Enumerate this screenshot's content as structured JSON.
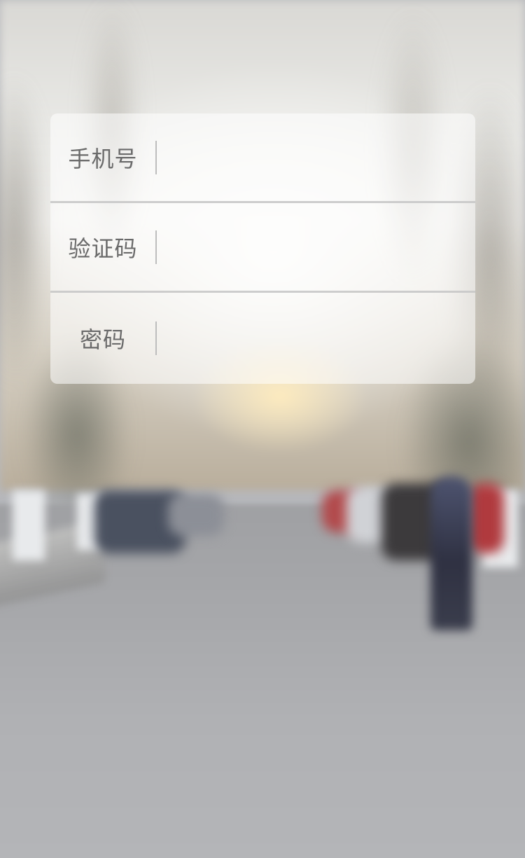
{
  "login_form": {
    "fields": [
      {
        "label": "手机号",
        "value": "",
        "placeholder": ""
      },
      {
        "label": "验证码",
        "value": "",
        "placeholder": ""
      },
      {
        "label": "密码",
        "value": "",
        "placeholder": ""
      }
    ]
  }
}
